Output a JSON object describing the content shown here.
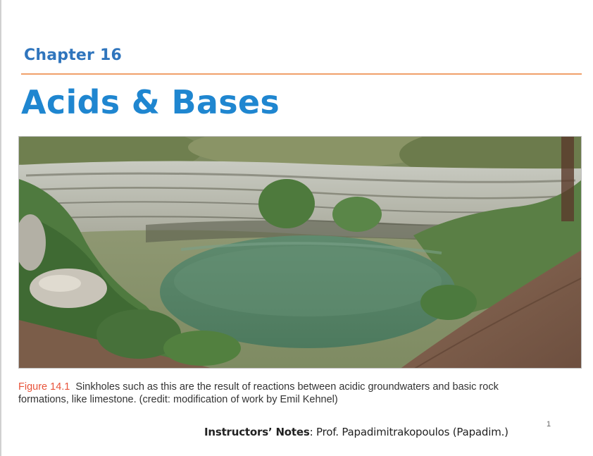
{
  "slide": {
    "chapter": "Chapter 16",
    "title": "Acids & Bases",
    "figure": {
      "label": "Figure 14.1",
      "caption_line1": "Sinkholes such as this are the result of reactions between acidic groundwaters and basic rock",
      "caption_line2": "formations, like limestone. (credit: modification of work by Emil Kehnel)"
    },
    "notes": {
      "label": "Instructors’ Notes",
      "text": ": Prof. Papadimitrakopoulos (Papadim.)"
    },
    "page_number": "1"
  },
  "colors": {
    "chapter": "#2f75bd",
    "title": "#1f86d0",
    "rule": "#f0a06a",
    "figure_label": "#e8533a"
  }
}
